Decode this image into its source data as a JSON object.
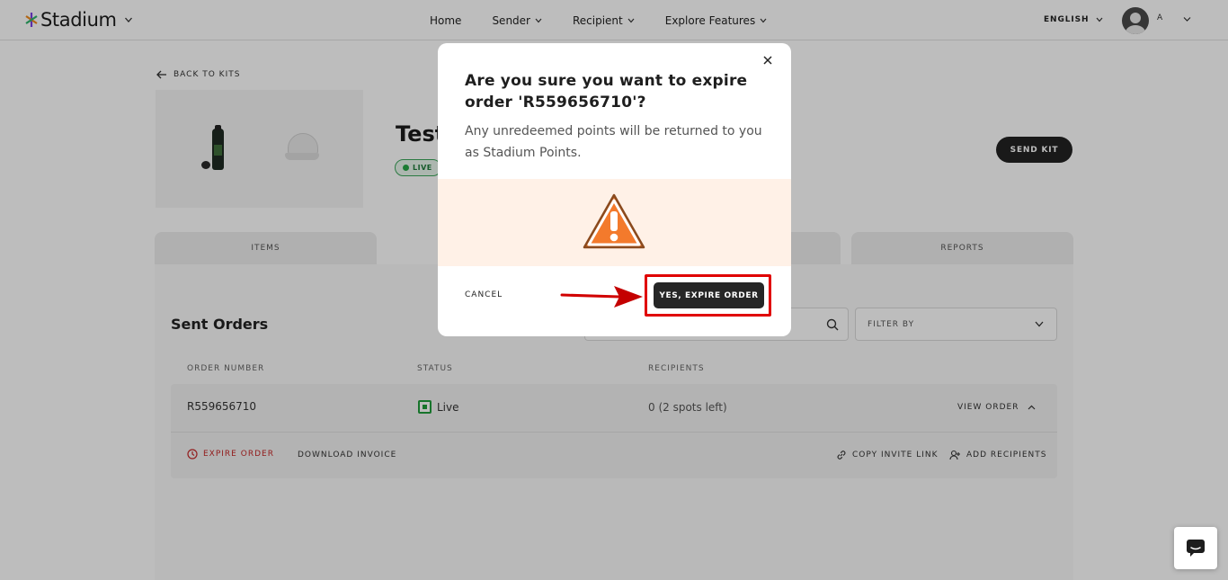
{
  "header": {
    "brand": "Stadium",
    "nav": [
      "Home",
      "Sender",
      "Recipient",
      "Explore Features"
    ],
    "language": "ENGLISH",
    "user_initial": "A"
  },
  "page": {
    "back_label": "BACK TO KITS",
    "kit_title": "Test",
    "kit_status": "LIVE",
    "send_kit_label": "SEND KIT",
    "tabs": [
      "ITEMS",
      "",
      "",
      "REPORTS"
    ],
    "section_title": "Sent Orders",
    "filter_label": "FILTER BY",
    "columns": [
      "ORDER NUMBER",
      "STATUS",
      "RECIPIENTS"
    ],
    "order": {
      "number": "R559656710",
      "status": "Live",
      "recipients": "0 (2 spots left)",
      "view_order": "VIEW ORDER",
      "expire_order": "EXPIRE ORDER",
      "download_invoice": "DOWNLOAD INVOICE",
      "copy_invite_link": "COPY INVITE LINK",
      "add_recipients": "ADD RECIPIENTS"
    }
  },
  "modal": {
    "title": "Are you sure you want to expire order 'R559656710'?",
    "body": "Any unredeemed points will be returned to you as Stadium Points.",
    "cancel_label": "CANCEL",
    "confirm_label": "YES, EXPIRE ORDER",
    "warning_color": "#f37a2c",
    "highlight_color": "#e00000"
  },
  "icons": {
    "close": "close-icon",
    "warning": "warning-triangle-icon",
    "search": "search-icon",
    "chat": "chat-icon"
  }
}
